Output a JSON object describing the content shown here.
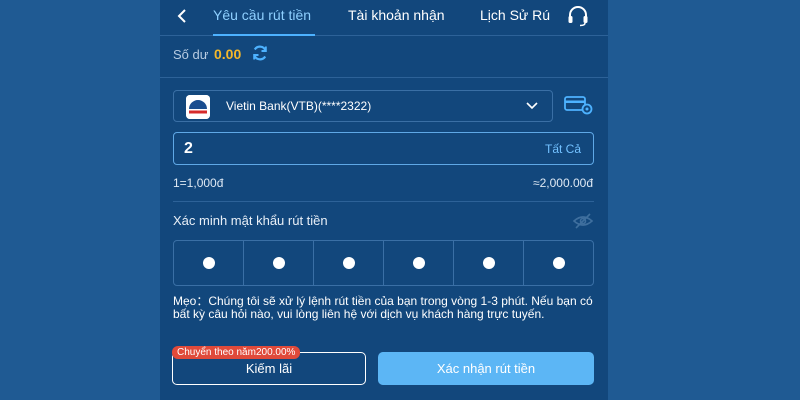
{
  "colors": {
    "page_bg": "#1f5a93",
    "panel_bg": "#12477c",
    "accent": "#4db2ff",
    "balance": "#f4b72a",
    "confirm": "#5cb6f5",
    "promo": "#e04a3a"
  },
  "header": {
    "back_icon": "chevron-left-icon",
    "tabs": [
      {
        "label": "Yêu cầu rút tiền",
        "active": true
      },
      {
        "label": "Tài khoản nhận",
        "active": false
      },
      {
        "label": "Lịch Sử Rú",
        "active": false
      }
    ],
    "support_icon": "headset-icon"
  },
  "balance": {
    "label": "Số dư",
    "value": "0.00",
    "refresh_icon": "refresh-icon"
  },
  "bank": {
    "name": "Vietin Bank(VTB)(****2322)",
    "logo_icon": "vietinbank-logo-icon",
    "dropdown_icon": "chevron-down-icon",
    "card_settings_icon": "card-settings-icon"
  },
  "amount": {
    "value": "2",
    "all_label": "Tất Cả"
  },
  "rate": {
    "left": "1=1,000đ",
    "right": "≈2,000.00đ"
  },
  "password": {
    "label": "Xác minh mật khẩu rút tiền",
    "eye_icon": "eye-hidden-icon",
    "pin_count": 6
  },
  "tip": "Mẹo：Chúng tôi sẽ xử lý lệnh rút tiền của bạn trong vòng 1-3 phút. Nếu bạn có bất kỳ câu hỏi nào, vui lòng liên hệ với dịch vụ khách hàng trực tuyến.",
  "buttons": {
    "promo_badge": "Chuyển theo năm200.00%",
    "earn_label": "Kiếm lãi",
    "confirm_label": "Xác nhận rút tiền"
  }
}
